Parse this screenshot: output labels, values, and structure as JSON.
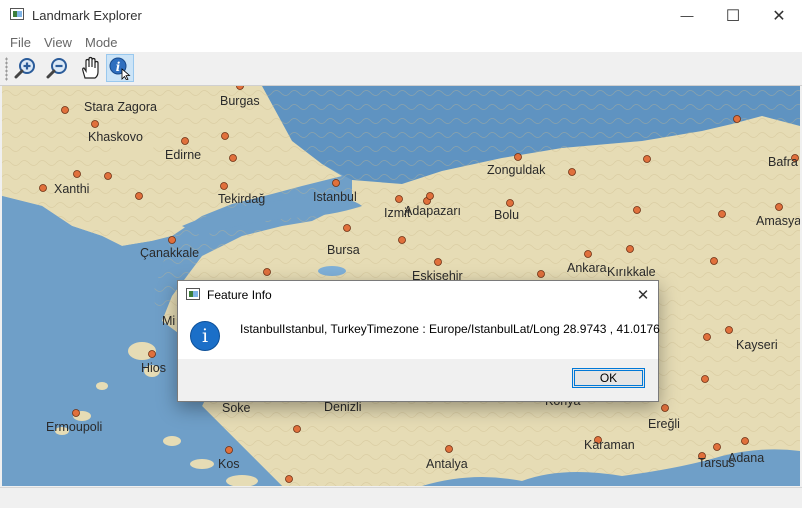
{
  "window": {
    "title": "Landmark Explorer",
    "minimize_glyph": "—",
    "maximize_glyph": "☐",
    "close_glyph": "✕"
  },
  "menu": {
    "items": [
      "File",
      "View",
      "Mode"
    ]
  },
  "toolbar": {
    "tools": [
      "zoom-in-icon",
      "zoom-out-icon",
      "pan-hand-icon",
      "info-pointer-icon"
    ],
    "active_tool": "info-pointer-icon"
  },
  "map": {
    "labels": [
      "Stara Zagora",
      "Burgas",
      "Khaskovo",
      "Edirne",
      "Xanthi",
      "Tekirdağ",
      "Istanbul",
      "Izmit",
      "Adapazarı",
      "Zonguldak",
      "Bolu",
      "Bafra",
      "Amasya",
      "Çanakkale",
      "Bursa",
      "Eskişehir",
      "Ankara",
      "Kırıkkale",
      "Kayseri",
      "Hios",
      "Soke",
      "Denizli",
      "Konya",
      "Ereğli",
      "Karaman",
      "Adana",
      "Tarsus",
      "Ermoupoli",
      "Kos",
      "Antalya",
      "Mi"
    ],
    "colors": {
      "sea": "#6f9fc8",
      "land": "#e6dcb5",
      "marker": "#e0703c"
    }
  },
  "dialog": {
    "title": "Feature Info",
    "message": "IstanbulIstanbul, TurkeyTimezone : Europe/IstanbulLat/Long 28.9743 , 41.0176",
    "ok_label": "OK",
    "close_glyph": "✕",
    "info_glyph": "i"
  }
}
